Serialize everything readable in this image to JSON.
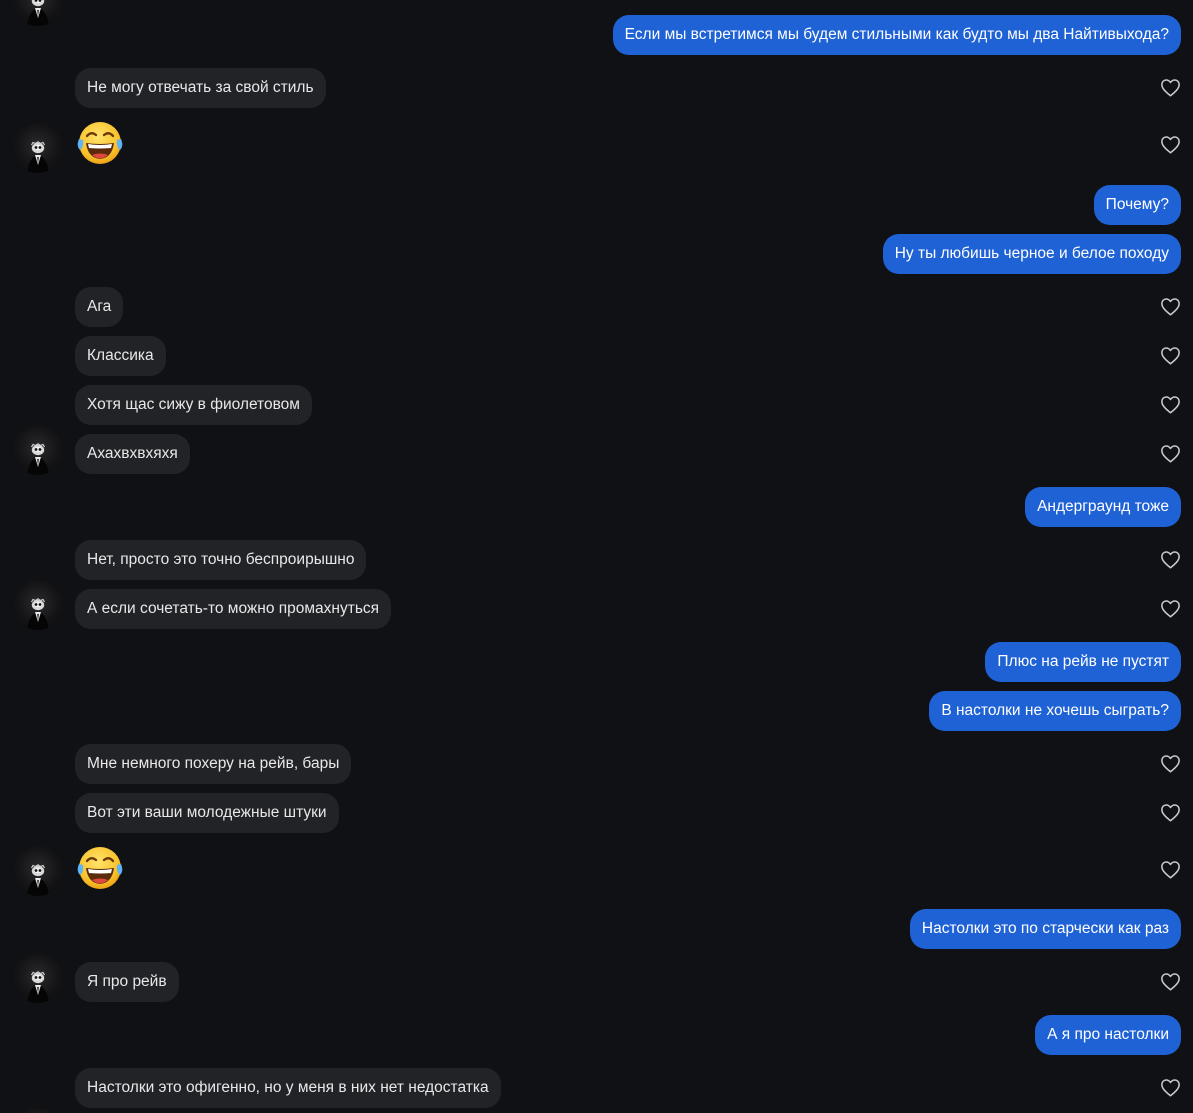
{
  "colors": {
    "background": "#101114",
    "incoming_bubble": "#222326",
    "outgoing_bubble": "#1f62d6",
    "incoming_text": "#e8e8ea",
    "outgoing_text": "#ffffff",
    "heart_outline": "#c9cacd"
  },
  "icons": {
    "like": "heart-outline-icon",
    "avatar": "contact-avatar",
    "emoji": "face-with-tears-of-joy-emoji"
  },
  "messages": [
    {
      "dir": "out",
      "kind": "text",
      "text": "Если мы встретимся мы будем стильными как будто мы два Найтивыхода?"
    },
    {
      "dir": "in",
      "kind": "text",
      "text": "Не могу отвечать за свой стиль"
    },
    {
      "dir": "in",
      "kind": "emoji",
      "text": "😂"
    },
    {
      "dir": "out",
      "kind": "text",
      "text": "Почему?"
    },
    {
      "dir": "out",
      "kind": "text",
      "text": "Ну ты любишь черное и белое походу"
    },
    {
      "dir": "in",
      "kind": "text",
      "text": "Ага"
    },
    {
      "dir": "in",
      "kind": "text",
      "text": "Классика"
    },
    {
      "dir": "in",
      "kind": "text",
      "text": "Хотя щас сижу в фиолетовом"
    },
    {
      "dir": "in",
      "kind": "text",
      "text": "Ахахвхвхяхя"
    },
    {
      "dir": "out",
      "kind": "text",
      "text": "Андерграунд тоже"
    },
    {
      "dir": "in",
      "kind": "text",
      "text": "Нет, просто это точно беспроирышно"
    },
    {
      "dir": "in",
      "kind": "text",
      "text": "А если сочетать-то можно промахнуться"
    },
    {
      "dir": "out",
      "kind": "text",
      "text": "Плюс на рейв не пустят"
    },
    {
      "dir": "out",
      "kind": "text",
      "text": "В настолки не хочешь сыграть?"
    },
    {
      "dir": "in",
      "kind": "text",
      "text": "Мне немного похеру на рейв, бары"
    },
    {
      "dir": "in",
      "kind": "text",
      "text": "Вот эти ваши молодежные штуки"
    },
    {
      "dir": "in",
      "kind": "emoji",
      "text": "😂"
    },
    {
      "dir": "out",
      "kind": "text",
      "text": "Настолки это по старчески как раз"
    },
    {
      "dir": "in",
      "kind": "text",
      "text": "Я про рейв"
    },
    {
      "dir": "out",
      "kind": "text",
      "text": "А я про настолки"
    },
    {
      "dir": "in",
      "kind": "text",
      "text": "Настолки это офигенно, но у меня в них нет недостатка"
    }
  ]
}
